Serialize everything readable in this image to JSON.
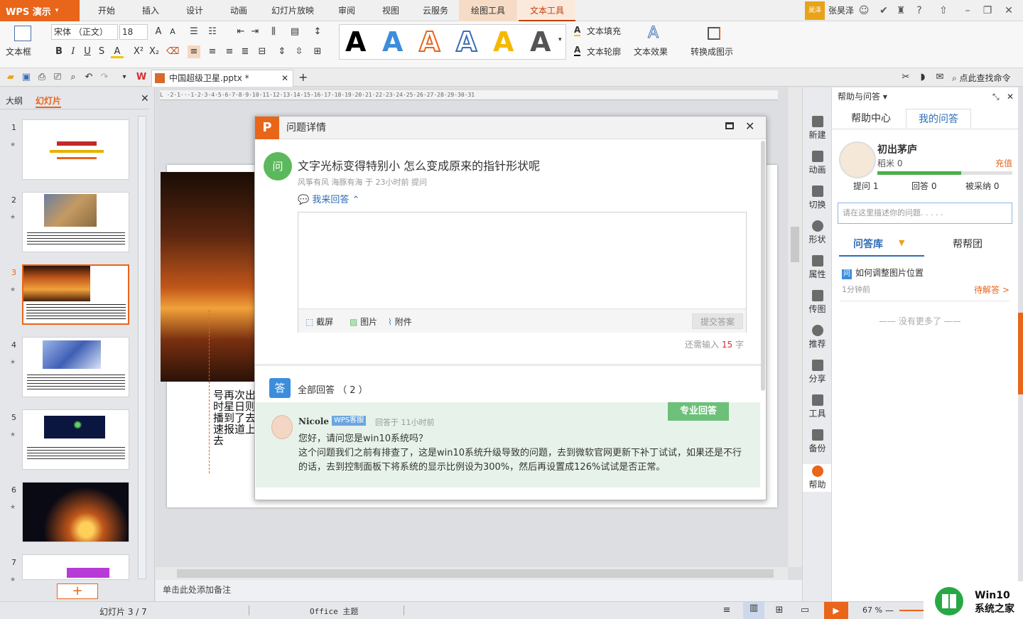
{
  "app": {
    "name": "WPS 演示",
    "active_tab_color": "#c2410c",
    "accent": "#e8651a"
  },
  "menu": [
    {
      "label": "开始"
    },
    {
      "label": "插入"
    },
    {
      "label": "设计"
    },
    {
      "label": "动画"
    },
    {
      "label": "幻灯片放映"
    },
    {
      "label": "审阅"
    },
    {
      "label": "视图"
    },
    {
      "label": "云服务"
    },
    {
      "label": "绘图工具"
    },
    {
      "label": "文本工具"
    }
  ],
  "user": {
    "badge": "昊泽",
    "name": "张昊泽"
  },
  "ribbon": {
    "textbox_label": "文本框",
    "font_name": "宋体 （正文）",
    "font_size": "18",
    "text_fill": "文本填充",
    "text_outline": "文本轮廓",
    "text_effect": "文本效果",
    "convert": "转换成图示"
  },
  "quickbar": {
    "doc_title": "中国超级卫星.pptx *",
    "search": "点此查找命令"
  },
  "left_panel": {
    "tab_outline": "大纲",
    "tab_slides": "幻灯片",
    "slides": [
      "1",
      "2",
      "3",
      "4",
      "5",
      "6",
      "7"
    ]
  },
  "slide": {
    "text": "号再次出时星日则播到了去速报道上去"
  },
  "notes_placeholder": "单击此处添加备注",
  "dialog": {
    "title": "问题详情",
    "q_icon": "问",
    "question": "文字光标变得特别小 怎么变成原来的指针形状呢",
    "meta": "风筝有风 海豚有海 于 23小时前 提问",
    "my_answer": "我来回答",
    "tool_screenshot": "截屏",
    "tool_image": "图片",
    "tool_attach": "附件",
    "submit": "提交答案",
    "remain_prefix": "还需输入",
    "remain_count": "15",
    "remain_suffix": "字",
    "a_icon": "答",
    "all_answers": "全部回答 （ 2 ）",
    "pro_badge": "专业回答",
    "answer_user": "Nicole",
    "answer_tag": "WPS客服",
    "answer_time": "回答于 11小时前",
    "answer_line1": "您好，请问您是win10系统吗？",
    "answer_line2": "这个问题我们之前有排查了，这是win10系统升级导致的问题，去到微软官网更新下补丁试试，如果还是不行的话，去到控制面板下将系统的显示比例设为300%，然后再设置成126%试试是否正常。"
  },
  "sidebar": [
    "新建",
    "动画",
    "切换",
    "形状",
    "属性",
    "传图",
    "推荐",
    "分享",
    "工具",
    "备份",
    "帮助"
  ],
  "help": {
    "header": "帮助与问答",
    "tab_center": "帮助中心",
    "tab_mine": "我的问答",
    "name": "初出茅庐",
    "rank": "稻米 0",
    "recharge": "充值",
    "progress": 0.62,
    "stat_ask": "提问 1",
    "stat_answer": "回答 0",
    "stat_accepted": "被采纳 0",
    "input_placeholder": "请在这里描述你的问题. . . . .",
    "tab_library": "问答库",
    "tab_group": "帮帮团",
    "q_icon": "问",
    "q_title": "如何调整图片位置",
    "q_time": "1分钟前",
    "q_status": "待解答 >",
    "no_more": "—— 没有更多了 ——"
  },
  "status": {
    "slide_info": "幻灯片 3 / 7",
    "theme": "Office 主题",
    "zoom": "67 %"
  },
  "watermark": {
    "line1": "Win10",
    "line2": "系统之家"
  }
}
